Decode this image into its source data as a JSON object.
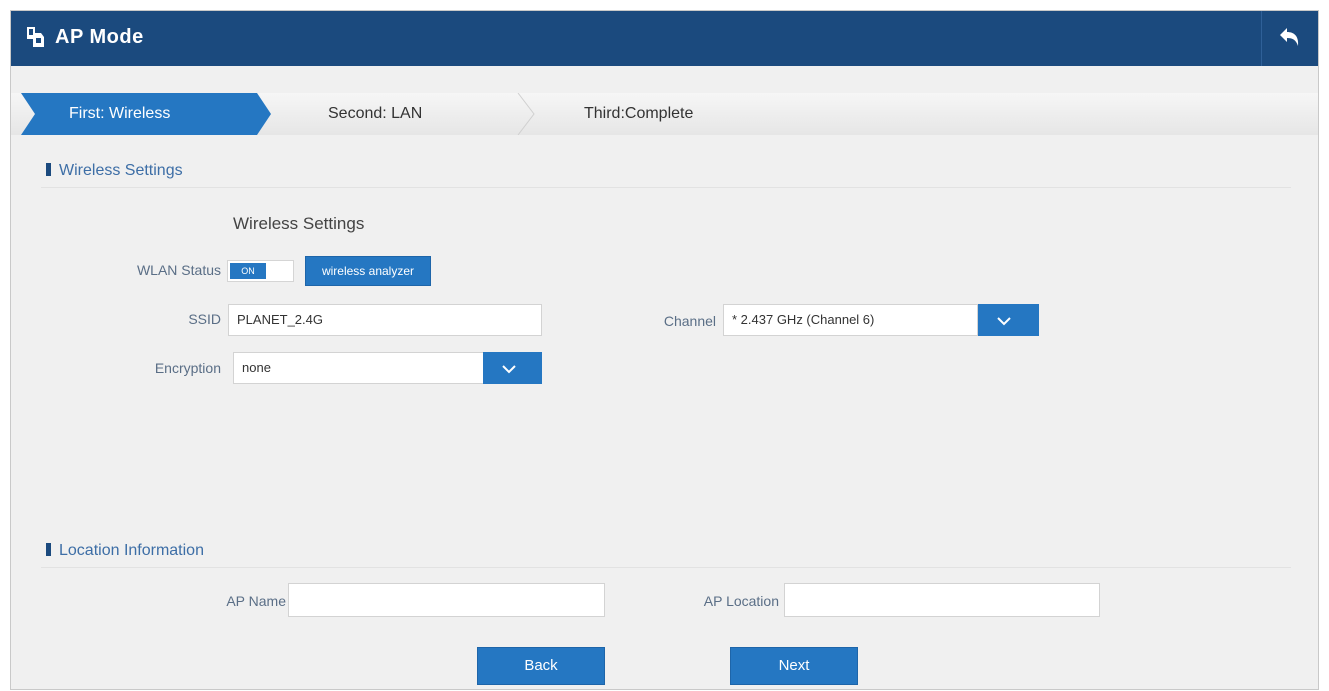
{
  "header": {
    "title": "AP Mode",
    "logo_icon": "cable-plug-icon",
    "back_icon": "return-arrow-icon"
  },
  "steps": [
    {
      "label": "First: Wireless",
      "active": true
    },
    {
      "label": "Second:  LAN",
      "active": false
    },
    {
      "label": "Third:Complete",
      "active": false
    }
  ],
  "wireless": {
    "section_title": "Wireless Settings",
    "sub_title": "Wireless Settings",
    "wlan_status_label": "WLAN Status",
    "toggle_label": "ON",
    "analyzer_button": "wireless analyzer",
    "ssid_label": "SSID",
    "ssid_value": "PLANET_2.4G",
    "channel_label": "Channel",
    "channel_value": "* 2.437 GHz (Channel 6)",
    "encryption_label": "Encryption",
    "encryption_value": "none"
  },
  "location": {
    "section_title": "Location Information",
    "ap_name_label": "AP Name",
    "ap_name_value": "",
    "ap_location_label": "AP Location",
    "ap_location_value": ""
  },
  "buttons": {
    "back": "Back",
    "next": "Next"
  },
  "colors": {
    "header": "#1b4a7e",
    "accent": "#2577c2",
    "background": "#f0f0f0"
  }
}
